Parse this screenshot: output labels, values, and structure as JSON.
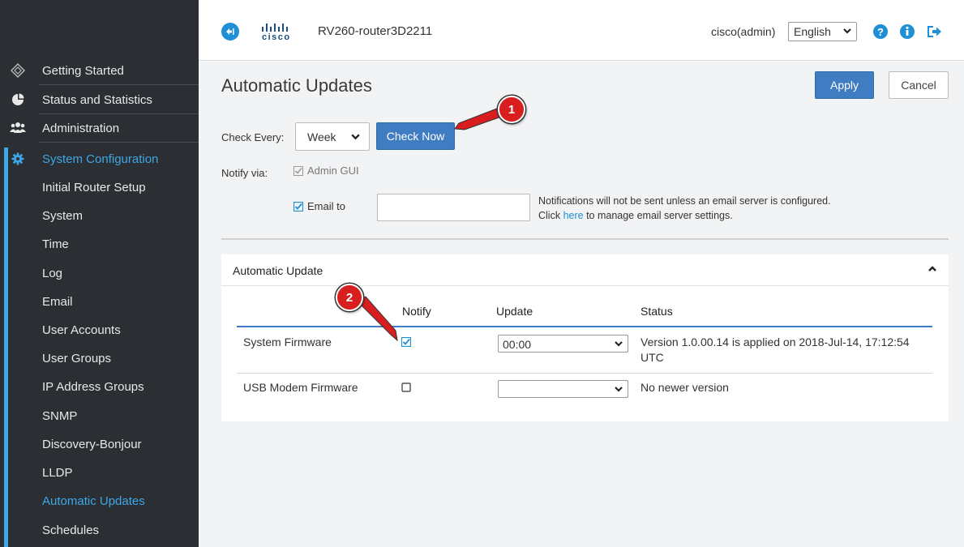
{
  "header": {
    "brand": "cisco",
    "router_name": "RV260-router3D2211",
    "user": "cisco(admin)",
    "language": "English"
  },
  "sidebar": {
    "top_items": [
      {
        "label": "Getting Started",
        "icon": "getting-started-icon"
      },
      {
        "label": "Status and Statistics",
        "icon": "pie-chart-icon"
      },
      {
        "label": "Administration",
        "icon": "users-icon"
      },
      {
        "label": "System Configuration",
        "icon": "gear-icon"
      }
    ],
    "sub_items": [
      "Initial Router Setup",
      "System",
      "Time",
      "Log",
      "Email",
      "User Accounts",
      "User Groups",
      "IP Address Groups",
      "SNMP",
      "Discovery-Bonjour",
      "LLDP",
      "Automatic Updates",
      "Schedules"
    ],
    "active_sub": "Automatic Updates"
  },
  "page": {
    "title": "Automatic Updates",
    "apply_label": "Apply",
    "cancel_label": "Cancel",
    "check_every_label": "Check Every:",
    "check_every_value": "Week",
    "check_now_label": "Check Now",
    "notify_via_label": "Notify via:",
    "admin_gui_label": "Admin GUI",
    "email_to_label": "Email to",
    "email_value": "",
    "email_note_line1": "Notifications will not be sent unless an email server is configured.",
    "email_note_click": "Click ",
    "email_note_link": "here",
    "email_note_rest": " to manage email server settings."
  },
  "panel": {
    "title": "Automatic Update",
    "columns": [
      "Notify",
      "Update",
      "Status"
    ],
    "rows": [
      {
        "name": "System Firmware",
        "notify": true,
        "update": "00:00",
        "status_line1": "Version 1.0.00.14 is applied on 2018-Jul-14, 17:12:54",
        "status_line2": "UTC"
      },
      {
        "name": "USB Modem Firmware",
        "notify": false,
        "update": "",
        "status_line1": "No newer version",
        "status_line2": ""
      }
    ]
  },
  "annotations": [
    "1",
    "2"
  ],
  "colors": {
    "accent": "#3ea7e6",
    "primary_button": "#3f7cc1",
    "sidebar_bg": "#2b2e33",
    "callout": "#d81e1e"
  }
}
